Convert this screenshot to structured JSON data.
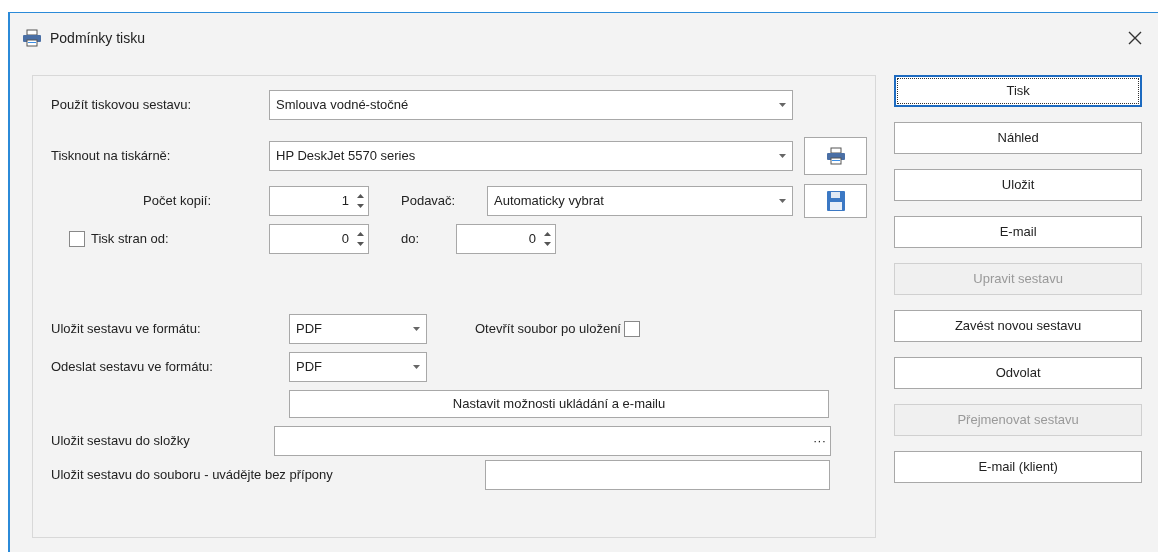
{
  "window": {
    "title": "Podmínky tisku"
  },
  "report": {
    "label": "Použít tiskovou sestavu:",
    "value": "Smlouva vodné-stočné"
  },
  "printer": {
    "label": "Tisknout na tiskárně:",
    "value": "HP DeskJet 5570 series"
  },
  "copies": {
    "label": "Počet kopií:",
    "value": "1"
  },
  "feeder": {
    "label": "Podavač:",
    "value": "Automaticky vybrat"
  },
  "page_range": {
    "label": "Tisk stran od:",
    "checked": false,
    "from": "0",
    "to_label": "do:",
    "to": "0"
  },
  "save_format": {
    "label": "Uložit sestavu ve formátu:",
    "value": "PDF"
  },
  "open_after_save": {
    "label": "Otevřít soubor po uložení",
    "checked": false
  },
  "send_format": {
    "label": "Odeslat sestavu ve formátu:",
    "value": "PDF"
  },
  "options_button": "Nastavit možnosti ukládání a e-mailu",
  "folder": {
    "label": "Uložit sestavu do složky",
    "browse": "···"
  },
  "file": {
    "label": "Uložit sestavu do souboru - uvádějte bez přípony"
  },
  "buttons": [
    {
      "label": "Tisk",
      "disabled": false,
      "focused": true
    },
    {
      "label": "Náhled",
      "disabled": false,
      "focused": false
    },
    {
      "label": "Uložit",
      "disabled": false,
      "focused": false
    },
    {
      "label": "E-mail",
      "disabled": false,
      "focused": false
    },
    {
      "label": "Upravit sestavu",
      "disabled": true,
      "focused": false
    },
    {
      "label": "Zavést novou sestavu",
      "disabled": false,
      "focused": false
    },
    {
      "label": "Odvolat",
      "disabled": false,
      "focused": false
    },
    {
      "label": "Přejmenovat sestavu",
      "disabled": true,
      "focused": false
    },
    {
      "label": "E-mail (klient)",
      "disabled": false,
      "focused": false
    }
  ]
}
